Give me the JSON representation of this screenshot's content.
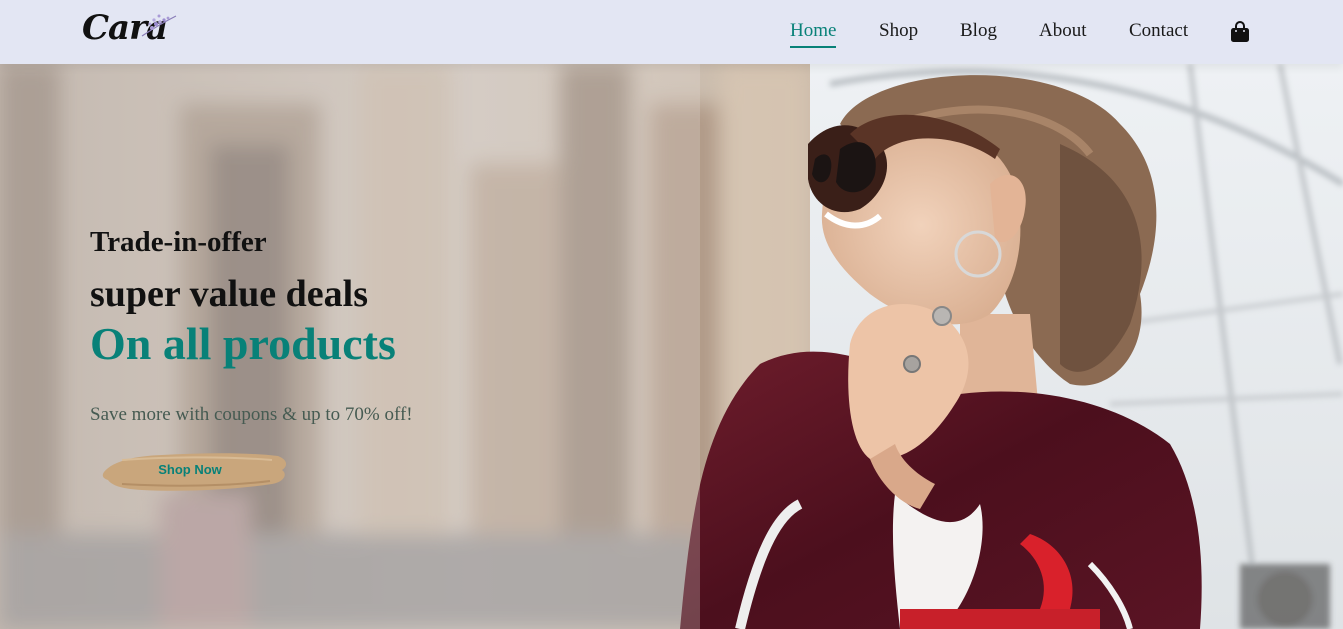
{
  "brand": {
    "logo_text": "Cara"
  },
  "nav": {
    "items": [
      {
        "label": "Home",
        "active": true
      },
      {
        "label": "Shop",
        "active": false
      },
      {
        "label": "Blog",
        "active": false
      },
      {
        "label": "About",
        "active": false
      },
      {
        "label": "Contact",
        "active": false
      }
    ],
    "cart_icon": "shopping-bag-icon"
  },
  "hero": {
    "kicker": "Trade-in-offer",
    "headline": "super value deals",
    "highlight": "On all products",
    "subtext": "Save more with coupons & up to 70% off!",
    "cta_label": "Shop Now",
    "image": "woman-with-sunglasses-shopping-bags"
  },
  "colors": {
    "accent": "#088178",
    "header_bg": "#e3e6f3",
    "button_brush": "#c9a67c"
  }
}
